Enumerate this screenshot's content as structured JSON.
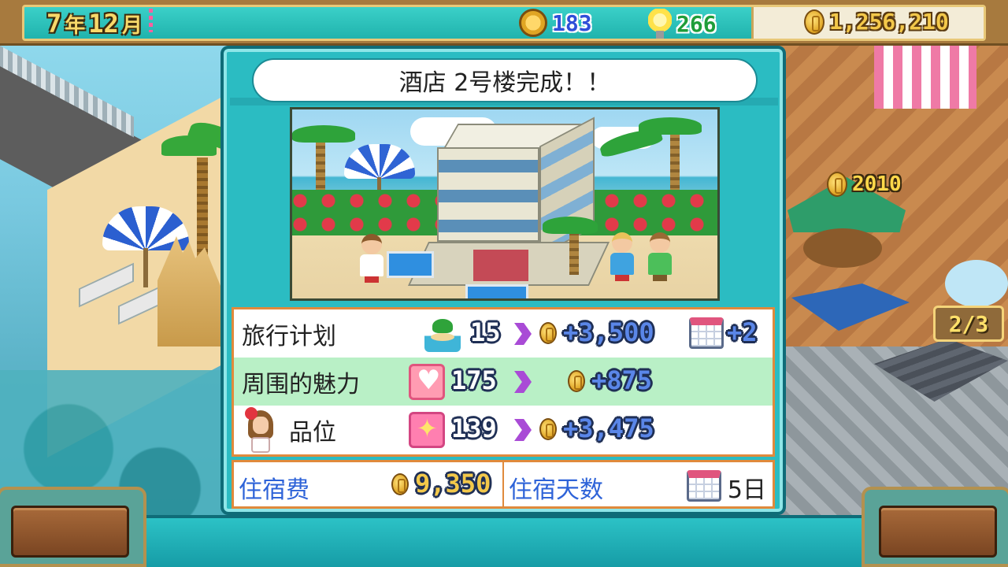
{
  "topbar": {
    "year": "7",
    "year_unit": "年",
    "month": "12",
    "month_unit": "月",
    "medals": "183",
    "ideas": "266",
    "money": "1,256,210",
    "icons": {
      "medals": "medal-icon",
      "ideas": "lightbulb-icon",
      "money": "coin-icon"
    }
  },
  "world": {
    "floating_coin_value": "2010",
    "progress_badge": "2/3"
  },
  "dialog": {
    "title": "酒店 2号楼完成！！",
    "stats": [
      {
        "label": "旅行计划",
        "icon": "island-icon",
        "points": "15",
        "bonus": "+3,500",
        "extra_icon": "calendar-icon",
        "extra": "+2"
      },
      {
        "label": "周围的魅力",
        "icon": "heart-icon",
        "points": "175",
        "bonus": "+875"
      },
      {
        "label": "品位",
        "icon": "sparkle-icon",
        "points": "139",
        "bonus": "+3,475"
      }
    ],
    "lodging_fee_label": "住宿费",
    "lodging_fee_value": "9,350",
    "stay_days_label": "住宿天数",
    "stay_days_value": "5日"
  },
  "colors": {
    "dialog_bg": "#2bbcc2",
    "accent_row": "#b9f0c6",
    "border_orange": "#e08a3c",
    "label_blue": "#2e63d8",
    "money_gold": "#f3c84a"
  }
}
